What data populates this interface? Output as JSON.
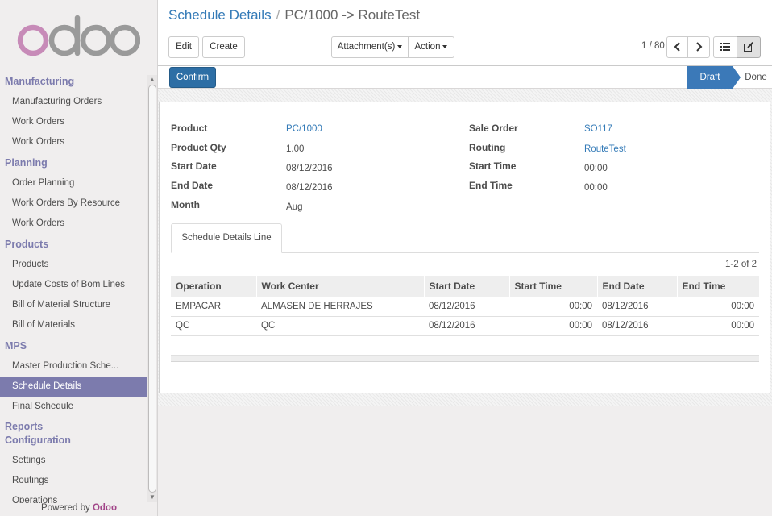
{
  "brand": {
    "logo_text": "odoo",
    "powered_prefix": "Powered by",
    "powered_brand": "Odoo"
  },
  "sidebar": {
    "sections": [
      {
        "label": "Manufacturing",
        "items": [
          "Manufacturing Orders",
          "Work Orders",
          "Work Orders"
        ]
      },
      {
        "label": "Planning",
        "items": [
          "Order Planning",
          "Work Orders By Resource",
          "Work Orders"
        ]
      },
      {
        "label": "Products",
        "items": [
          "Products",
          "Update Costs of Bom Lines",
          "Bill of Material Structure",
          "Bill of Materials"
        ]
      },
      {
        "label": "MPS",
        "items": [
          "Master Production Sche...",
          "Schedule Details",
          "Final Schedule"
        ]
      },
      {
        "label": "Reports",
        "items": []
      },
      {
        "label": "Configuration",
        "items": [
          "Settings",
          "Routings",
          "Operations"
        ]
      }
    ],
    "active_item": "Schedule Details"
  },
  "breadcrumb": {
    "parent": "Schedule Details",
    "separator": "/",
    "current": "PC/1000 -> RouteTest"
  },
  "toolbar": {
    "edit_label": "Edit",
    "create_label": "Create",
    "attachments_label": "Attachment(s)",
    "action_label": "Action",
    "pager": "1 / 80"
  },
  "statusbar": {
    "confirm_label": "Confirm",
    "stages": [
      "Draft",
      "Done"
    ],
    "current_stage": "Draft"
  },
  "form": {
    "product_label": "Product",
    "product_value": "PC/1000",
    "qty_label": "Product Qty",
    "qty_value": "1.00",
    "start_date_label": "Start Date",
    "start_date_value": "08/12/2016",
    "end_date_label": "End Date",
    "end_date_value": "08/12/2016",
    "month_label": "Month",
    "month_value": "Aug",
    "sale_order_label": "Sale Order",
    "sale_order_value": "SO117",
    "routing_label": "Routing",
    "routing_value": "RouteTest",
    "start_time_label": "Start Time",
    "start_time_value": "00:00",
    "end_time_label": "End Time",
    "end_time_value": "00:00"
  },
  "lines": {
    "tab_label": "Schedule Details Line",
    "counter": "1-2 of 2",
    "columns": [
      "Operation",
      "Work Center",
      "Start Date",
      "Start Time",
      "End Date",
      "End Time"
    ],
    "rows": [
      [
        "EMPACAR",
        "ALMASEN DE HERRAJES",
        "08/12/2016",
        "00:00",
        "08/12/2016",
        "00:00"
      ],
      [
        "QC",
        "QC",
        "08/12/2016",
        "00:00",
        "08/12/2016",
        "00:00"
      ]
    ]
  },
  "colors": {
    "accent": "#7c7bad",
    "primary": "#2d6ea5",
    "link": "#337ab7",
    "brand": "#a24689"
  }
}
